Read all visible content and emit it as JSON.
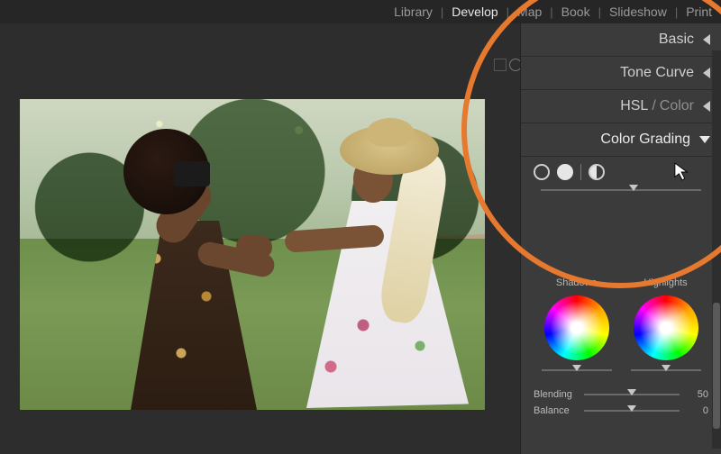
{
  "nav": {
    "items": [
      "Library",
      "Develop",
      "Map",
      "Book",
      "Slideshow",
      "Print"
    ],
    "active_index": 1
  },
  "panels": {
    "basic": {
      "title": "Basic"
    },
    "tone_curve": {
      "title": "Tone Curve"
    },
    "hsl_color": {
      "title_a": "HSL",
      "sep": "/",
      "title_b": "Color"
    },
    "color_grading": {
      "title": "Color Grading",
      "wheels": [
        {
          "label": "Shadows"
        },
        {
          "label": "Highlights"
        }
      ],
      "blending": {
        "label": "Blending",
        "value": 50,
        "pos_pct": 50
      },
      "balance": {
        "label": "Balance",
        "value": 0,
        "pos_pct": 50
      }
    }
  },
  "highlight_color": "#e7792f"
}
